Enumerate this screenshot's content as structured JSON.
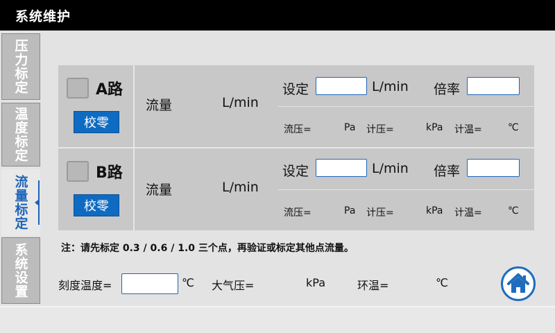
{
  "header": {
    "title": "系统维护"
  },
  "tabs": [
    {
      "label": "压力标定",
      "active": false
    },
    {
      "label": "温度标定",
      "active": false
    },
    {
      "label": "流量标定",
      "active": true
    },
    {
      "label": "系统设置",
      "active": false
    }
  ],
  "routes": [
    {
      "name": "A路",
      "zero_label": "校零",
      "flow_label": "流量",
      "flow_unit": "L/min",
      "set_label": "设定",
      "set_value": "",
      "set_unit": "L/min",
      "ratio_label": "倍率",
      "ratio_value": "",
      "flow_pressure_label": "流压=",
      "flow_pressure_unit": "Pa",
      "meter_pressure_label": "计压=",
      "meter_pressure_unit": "kPa",
      "meter_temp_label": "计温=",
      "meter_temp_unit": "℃"
    },
    {
      "name": "B路",
      "zero_label": "校零",
      "flow_label": "流量",
      "flow_unit": "L/min",
      "set_label": "设定",
      "set_value": "",
      "set_unit": "L/min",
      "ratio_label": "倍率",
      "ratio_value": "",
      "flow_pressure_label": "流压=",
      "flow_pressure_unit": "Pa",
      "meter_pressure_label": "计压=",
      "meter_pressure_unit": "kPa",
      "meter_temp_label": "计温=",
      "meter_temp_unit": "℃"
    }
  ],
  "note": "注：请先标定 0.3 / 0.6 / 1.0 三个点，再验证或标定其他点流量。",
  "bottom": {
    "calib_temp_label": "刻度温度=",
    "calib_temp_value": "",
    "calib_temp_unit": "℃",
    "atm_label": "大气压=",
    "atm_unit": "kPa",
    "ambient_label": "环温=",
    "ambient_unit": "℃"
  },
  "colors": {
    "accent": "#1d63b8",
    "button": "#0f6bc2",
    "titlebar": "#000000",
    "panel": "#c8c8c8"
  },
  "icons": {
    "home": "home-icon"
  }
}
